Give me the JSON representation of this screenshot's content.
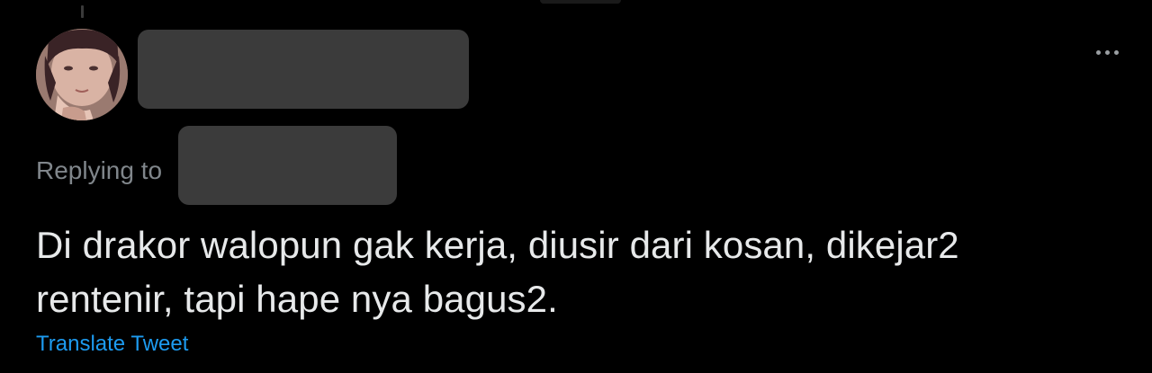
{
  "reply": {
    "replying_to_label": "Replying to",
    "text_lines": [
      "Di drakor walopun gak kerja, diusir dari kosan, dikejar2",
      "rentenir, tapi hape nya bagus2."
    ],
    "translate_label": "Translate Tweet"
  },
  "icons": {
    "more": "more-horizontal-icon"
  },
  "colors": {
    "background": "#000000",
    "text": "#e7e9ea",
    "muted": "#80868b",
    "link": "#1d9bf0",
    "redaction": "#3b3b3b"
  }
}
